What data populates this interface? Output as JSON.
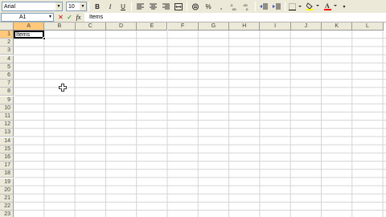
{
  "toolbar": {
    "font_name": "Arial",
    "font_size": "10",
    "bold_label": "B",
    "italic_label": "I",
    "underline_label": "U",
    "icons": [
      "bold-icon",
      "italic-icon",
      "underline-icon",
      "align-left-icon",
      "align-center-icon",
      "align-right-icon",
      "merge-center-icon",
      "currency-icon",
      "percent-icon",
      "increase-decimal-icon",
      "decrease-decimal-icon",
      "decrease-indent-icon",
      "increase-indent-icon",
      "borders-icon",
      "fill-color-icon",
      "font-color-icon"
    ],
    "colors": {
      "fill": "#ffff00",
      "font": "#ff0000"
    }
  },
  "formula_bar": {
    "name_box": "A1",
    "cancel": "✕",
    "enter": "✓",
    "fx": "fx",
    "content": "Items"
  },
  "columns": [
    "A",
    "B",
    "C",
    "D",
    "E",
    "F",
    "G",
    "H",
    "I",
    "J",
    "K",
    "L"
  ],
  "rows": [
    "1",
    "2",
    "3",
    "4",
    "5",
    "6",
    "7",
    "8",
    "9",
    "10",
    "11",
    "12",
    "13",
    "14",
    "15",
    "16",
    "17",
    "18",
    "19",
    "20",
    "21",
    "22",
    "23"
  ],
  "active_cell": {
    "ref": "A1",
    "value": "Items"
  },
  "colors": {
    "header_bg": "#ece9d8",
    "active_header": "#ffc87a",
    "grid_line": "#d4d4d4"
  }
}
